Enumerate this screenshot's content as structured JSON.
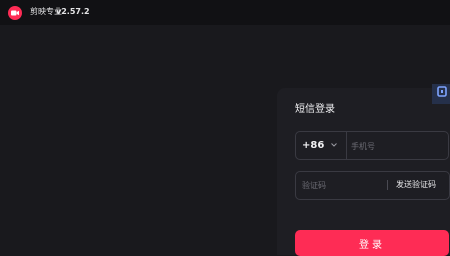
{
  "app": {
    "name": "剪映专业",
    "version": "v2.57.2"
  },
  "login": {
    "title": "短信登录",
    "country_code": "+86",
    "phone_placeholder": "手机号",
    "code_placeholder": "验证码",
    "send_code_label": "发送验证码",
    "submit_label": "登录"
  },
  "icons": {
    "app_logo": "video-camera-icon",
    "country_dropdown": "chevron-down-icon",
    "qr_toggle": "qr-code-icon"
  },
  "colors": {
    "accent": "#fe2c55",
    "background": "#19191d",
    "panel": "#1e1e23"
  }
}
